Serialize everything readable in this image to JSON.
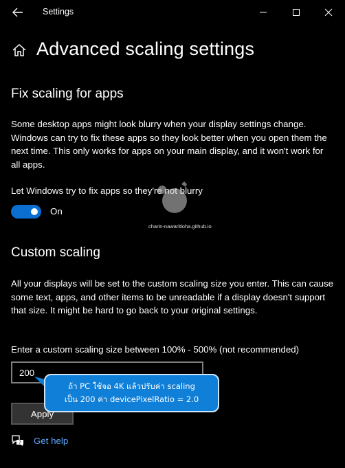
{
  "window": {
    "title": "Settings"
  },
  "page": {
    "title": "Advanced scaling settings"
  },
  "fix_apps": {
    "heading": "Fix scaling for apps",
    "description": "Some desktop apps might look blurry when your display settings change. Windows can try to fix these apps so they look better when you open them the next time. This only works for apps on your main display, and it won't work for all apps.",
    "toggle_label": "Let Windows try to fix apps so they're not blurry",
    "toggle_state": "On",
    "toggle_on": true
  },
  "custom_scaling": {
    "heading": "Custom scaling",
    "description": "All your displays will be set to the custom scaling size you enter. This can cause some text, apps, and other items to be unreadable if a display doesn't support that size. It might be hard to go back to your original settings.",
    "input_label": "Enter a custom scaling size between 100% - 500% (not recommended)",
    "input_value": "200",
    "apply_label": "Apply"
  },
  "help": {
    "label": "Get help"
  },
  "callout": {
    "line1": "ถ้า PC ใช้จอ 4K แล้วปรับค่า scaling",
    "line2": "เป็น 200 ค่า devicePixelRatio = 2.0"
  },
  "watermark": {
    "text": "charin-nawaritloha.github.io"
  },
  "icons": {
    "back": "back-arrow-icon",
    "minimize": "minimize-icon",
    "maximize": "maximize-icon",
    "close": "close-icon",
    "home": "home-icon",
    "help": "help-chat-icon"
  },
  "colors": {
    "background": "#000000",
    "accent": "#0a6fd0",
    "link": "#5ea9ff",
    "callout": "#0f7fd8"
  }
}
